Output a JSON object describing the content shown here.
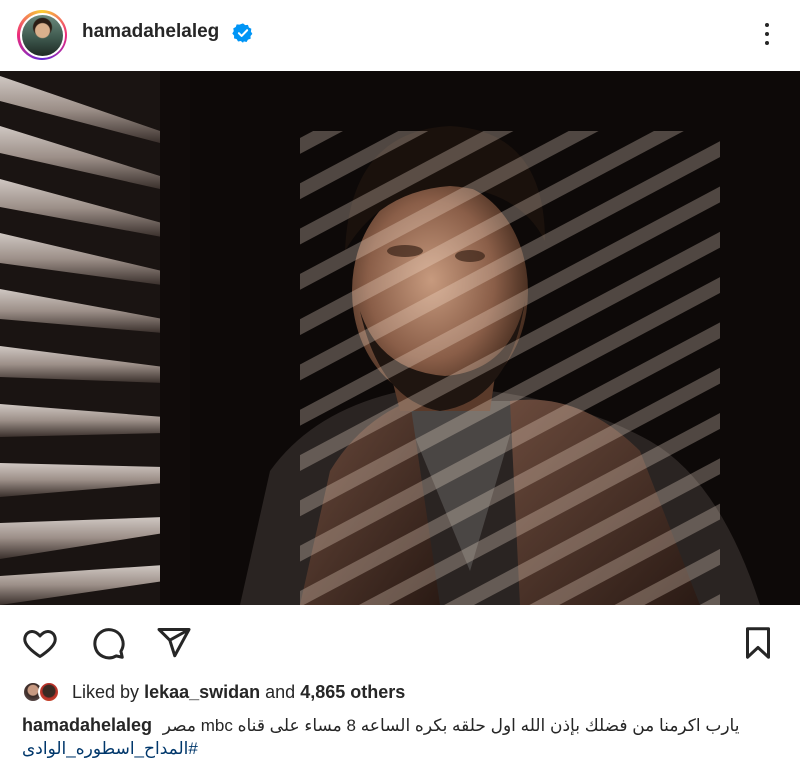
{
  "post": {
    "username": "hamadahelaleg",
    "verified": true,
    "icons": {
      "more": "more-vertical-icon",
      "like": "heart-icon",
      "comment": "comment-icon",
      "share": "send-icon",
      "save": "bookmark-icon",
      "verified": "verified-badge-icon"
    }
  },
  "likes": {
    "prefix": "Liked by",
    "first_user": "lekaa_swidan",
    "conjunction": "and",
    "others": "4,865 others"
  },
  "caption": {
    "username": "hamadahelaleg",
    "text": "يارب اكرمنا من فضلك بإذن الله اول حلقه بكره الساعه 8 مساء على قناه mbc مصر",
    "hashtag": "#المداح_اسطوره_الوادى"
  },
  "colors": {
    "verified_blue": "#0095f6",
    "hashtag_blue": "#00376b",
    "text": "#262626"
  }
}
